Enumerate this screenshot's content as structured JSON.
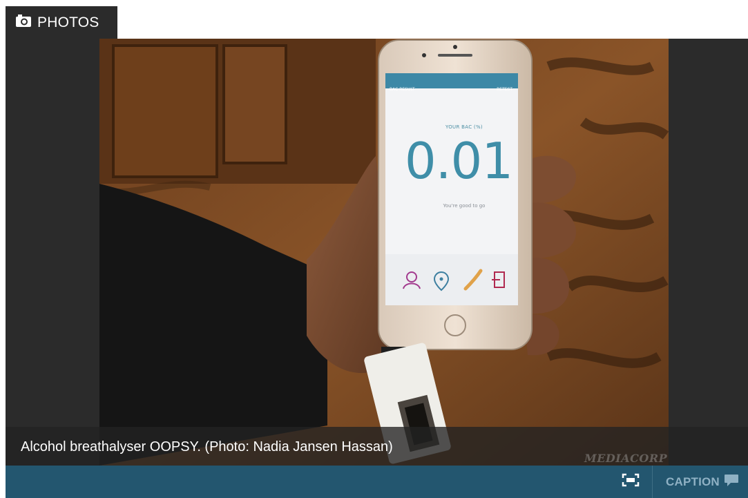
{
  "tab": {
    "icon": "camera-icon",
    "label": "PHOTOS"
  },
  "photo": {
    "screen_header_left": "BAC RESULT",
    "screen_header_right": "RETEST",
    "bac_heading": "YOUR BAC (%)",
    "bac_value": "0.01",
    "bac_message": "You're good to go",
    "app_icons": [
      "friends-icon",
      "location-pin-icon",
      "phone-call-icon",
      "exit-icon"
    ]
  },
  "caption": {
    "text": "Alcohol breathalyser OOPSY. (Photo: Nadia Jansen Hassan)",
    "watermark": "MEDIACORP"
  },
  "controls": {
    "fullscreen_icon": "fullscreen-icon",
    "caption_label": "CAPTION",
    "caption_icon": "speech-bubble-icon"
  },
  "colors": {
    "tab_background": "#2b2b2b",
    "control_bar": "#23566f",
    "bac_text": "#3f8ea8"
  }
}
